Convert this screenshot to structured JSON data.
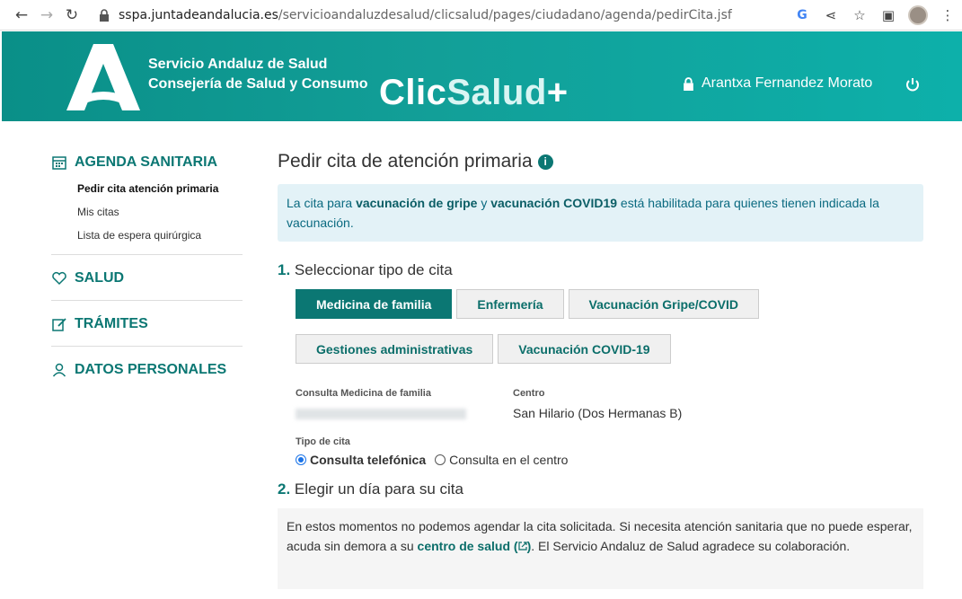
{
  "browser": {
    "url_host": "sspa.juntadeandalucia.es",
    "url_path": "/servicioandaluzdesalud/clicsalud/pages/ciudadano/agenda/pedirCita.jsf"
  },
  "header": {
    "org_line1": "Servicio Andaluz de Salud",
    "org_line2": "Consejería de Salud y Consumo",
    "brand_clic": "Clic",
    "brand_salud": "Salud",
    "brand_plus": "+",
    "user_name": "Arantxa Fernandez Morato"
  },
  "sidebar": {
    "agenda": "AGENDA SANITARIA",
    "sub_items": [
      "Pedir cita atención primaria",
      "Mis citas",
      "Lista de espera quirúrgica"
    ],
    "salud": "SALUD",
    "tramites": "TRÁMITES",
    "datos": "DATOS PERSONALES"
  },
  "main": {
    "title": "Pedir cita de atención primaria",
    "info_glyph": "i",
    "alert": {
      "t1": "La cita para ",
      "b1": "vacunación de gripe",
      "t2": " y ",
      "b2": "vacunación COVID19",
      "t3": " está habilitada para quienes tienen indicada la vacunación."
    },
    "step1": {
      "num": "1.",
      "label": "Seleccionar tipo de cita"
    },
    "types": [
      "Medicina de familia",
      "Enfermería",
      "Vacunación Gripe/COVID",
      "Gestiones administrativas",
      "Vacunación COVID-19"
    ],
    "consulta_label": "Consulta Medicina de familia",
    "centro_label": "Centro",
    "centro_value": "San Hilario (Dos Hermanas B)",
    "tipo_label": "Tipo de cita",
    "radio1": "Consulta telefónica",
    "radio2": "Consulta en el centro",
    "step2": {
      "num": "2.",
      "label": "Elegir un día para su cita"
    },
    "notice": {
      "t1": "En estos momentos no podemos agendar la cita solicitada. Si necesita atención sanitaria que no puede esperar, acuda sin demora a su ",
      "link": "centro de salud",
      "t2": ". El Servicio Andaluz de Salud agradece su colaboración."
    }
  },
  "colors": {
    "accent": "#0b7773",
    "header": "#129f98",
    "alert_bg": "#e3f2f7"
  }
}
